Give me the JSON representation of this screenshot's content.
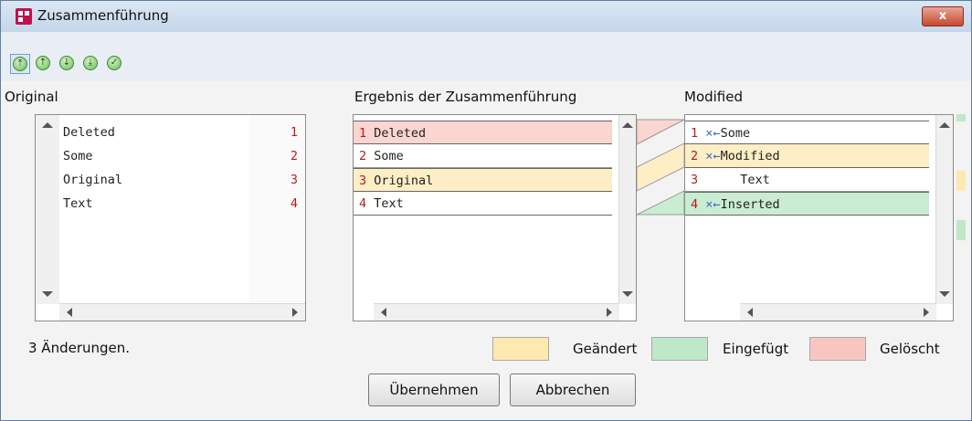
{
  "window": {
    "title": "Zusammenführung",
    "close_label": "x"
  },
  "toolbar": {
    "buttons": [
      {
        "icon": "merge-all-icon",
        "glyph": "⤒",
        "active": true
      },
      {
        "icon": "previous-change-icon",
        "glyph": "↑",
        "active": false
      },
      {
        "icon": "next-change-icon",
        "glyph": "↓",
        "active": false
      },
      {
        "icon": "last-change-icon",
        "glyph": "⤓",
        "active": false
      },
      {
        "icon": "accept-icon",
        "glyph": "✓",
        "active": false
      }
    ]
  },
  "original": {
    "label": "Original",
    "lines": [
      {
        "text": "Deleted",
        "num": "1"
      },
      {
        "text": "Some",
        "num": "2"
      },
      {
        "text": "Original",
        "num": "3"
      },
      {
        "text": "Text",
        "num": "4"
      }
    ]
  },
  "result": {
    "label": "Ergebnis der Zusammenführung",
    "lines": [
      {
        "num": "1",
        "text": "Deleted",
        "status": "deleted"
      },
      {
        "num": "2",
        "text": "Some",
        "status": "none"
      },
      {
        "num": "3",
        "text": "Original",
        "status": "changed"
      },
      {
        "num": "4",
        "text": "Text",
        "status": "none"
      }
    ]
  },
  "modified": {
    "label": "Modified",
    "lines": [
      {
        "num": "1",
        "x": "×",
        "arrow": "←",
        "text": "Some",
        "status": "none"
      },
      {
        "num": "2",
        "x": "×",
        "arrow": "←",
        "text": "Modified",
        "status": "changed"
      },
      {
        "num": "3",
        "x": "",
        "arrow": "",
        "text": "Text",
        "status": "none"
      },
      {
        "num": "4",
        "x": "×",
        "arrow": "←",
        "text": "Inserted",
        "status": "inserted"
      }
    ]
  },
  "status_text": "3 Änderungen.",
  "legend": [
    {
      "label": "Geändert",
      "color": "#fde9b0"
    },
    {
      "label": "Eingefügt",
      "color": "#bfe8c8"
    },
    {
      "label": "Gelöscht",
      "color": "#f8c6c0"
    }
  ],
  "buttons": {
    "apply": "Übernehmen",
    "cancel": "Abbrechen"
  },
  "colors": {
    "deleted": "#fbd5d0",
    "changed": "#fdeec6",
    "inserted": "#c9ecd2"
  }
}
